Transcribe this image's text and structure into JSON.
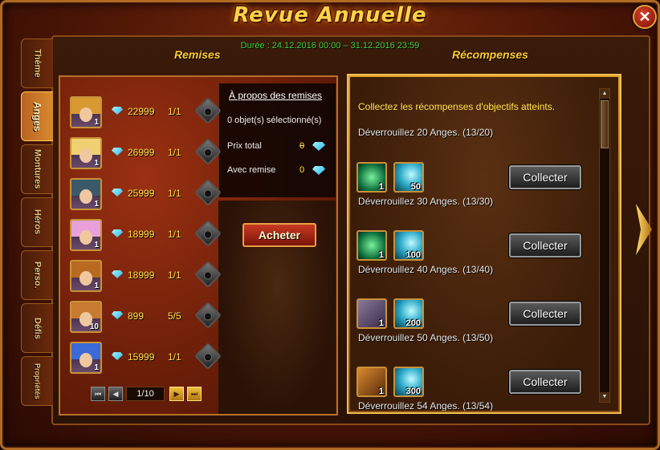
{
  "window": {
    "title": "Revue Annuelle",
    "close_glyph": "✕",
    "duration": "Durée : 24.12.2016 00:00 – 31.12.2016 23:59"
  },
  "headers": {
    "left": "Remises",
    "right": "Récompenses"
  },
  "tabs": [
    {
      "label": "Thème",
      "active": false
    },
    {
      "label": "Anges",
      "active": true
    },
    {
      "label": "Montures",
      "active": false
    },
    {
      "label": "Héros",
      "active": false
    },
    {
      "label": "Perso.",
      "active": false
    },
    {
      "label": "Défis",
      "active": false
    },
    {
      "label": "Propriétés",
      "active": false
    }
  ],
  "items": [
    {
      "level": "1",
      "price": "22999",
      "count": "1/1",
      "hair": "#d89a30"
    },
    {
      "level": "1",
      "price": "26999",
      "count": "1/1",
      "hair": "#f0d070"
    },
    {
      "level": "1",
      "price": "25999",
      "count": "1/1",
      "hair": "#3a5a6a"
    },
    {
      "level": "1",
      "price": "18999",
      "count": "1/1",
      "hair": "#e8a0d8"
    },
    {
      "level": "1",
      "price": "18999",
      "count": "1/1",
      "hair": "#b86a20"
    },
    {
      "level": "10",
      "price": "899",
      "count": "5/5",
      "hair": "#c87a30"
    },
    {
      "level": "1",
      "price": "15999",
      "count": "1/1",
      "hair": "#3a6ad8"
    }
  ],
  "pager": {
    "label": "1/10",
    "first": "⏮",
    "prev": "◀",
    "next": "▶",
    "last": "⏭"
  },
  "summary": {
    "about": "À propos des remises",
    "selected": "0 objet(s) sélectionné(s)",
    "total_label": "Prix total",
    "total_value": "0",
    "discount_label": "Avec remise",
    "discount_value": "0"
  },
  "buy_label": "Acheter",
  "rewards": {
    "intro": "Collectez les récompenses d'objectifs atteints.",
    "first_goal": "Déverrouillez 20 Anges. (13/20)",
    "goals": [
      {
        "icon_a": "emerald",
        "qty_a": "1",
        "qty_b": "50",
        "collect": "Collecter",
        "next_goal": "Déverrouillez 30 Anges. (13/30)"
      },
      {
        "icon_a": "emerald",
        "qty_a": "1",
        "qty_b": "100",
        "collect": "Collecter",
        "next_goal": "Déverrouillez 40 Anges. (13/40)"
      },
      {
        "icon_a": "crate",
        "qty_a": "1",
        "qty_b": "200",
        "collect": "Collecter",
        "next_goal": "Déverrouillez 50 Anges. (13/50)"
      },
      {
        "icon_a": "crate-orange",
        "qty_a": "1",
        "qty_b": "300",
        "collect": "Collecter",
        "next_goal": "Déverrouillez 54 Anges. (13/54)"
      }
    ]
  },
  "scroll": {
    "up": "▲",
    "down": "▼"
  },
  "colors": {
    "gold": "#ffcc33",
    "green": "#3fd23f",
    "price_yellow": "#ffe34a"
  }
}
